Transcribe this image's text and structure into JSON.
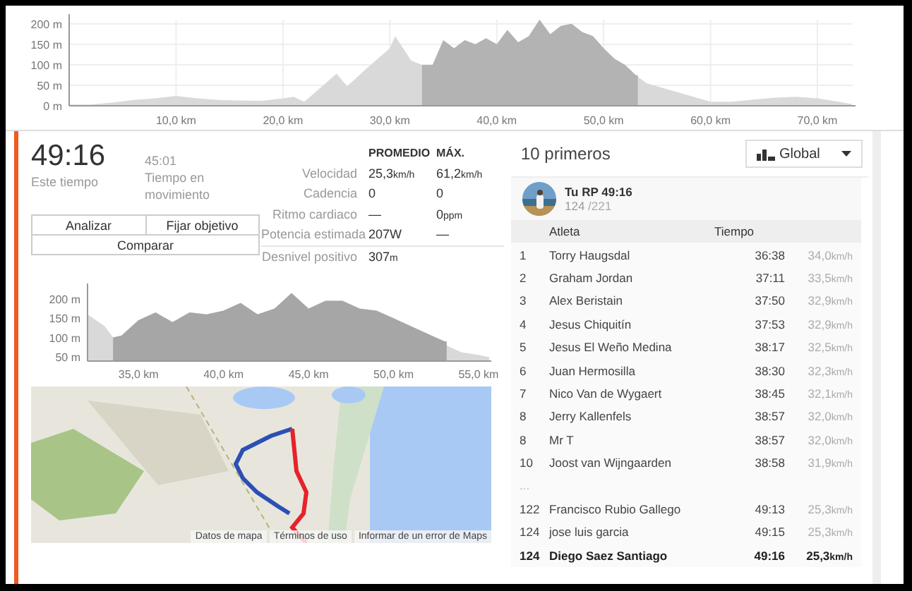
{
  "elevation_chart": {
    "chart_data": {
      "type": "area",
      "x": [
        0,
        2,
        4,
        6,
        8,
        10,
        12,
        14,
        16,
        18,
        20,
        21,
        22,
        24,
        25,
        26,
        28,
        30,
        30.5,
        32,
        33,
        34,
        35,
        36,
        37,
        38,
        39,
        40,
        41,
        42,
        43,
        44,
        45,
        46,
        47,
        48,
        49,
        50,
        51,
        52,
        53,
        54,
        56,
        58,
        60,
        62,
        64,
        66,
        68,
        70,
        72,
        73
      ],
      "series": [
        {
          "color": "#d9d9d9",
          "values": [
            3,
            3,
            8,
            14,
            18,
            24,
            18,
            14,
            13,
            12,
            18,
            22,
            10,
            55,
            78,
            48,
            95,
            140,
            170,
            110,
            100,
            100,
            160,
            140,
            160,
            150,
            165,
            150,
            185,
            155,
            170,
            210,
            175,
            195,
            200,
            180,
            170,
            140,
            115,
            100,
            75,
            55,
            40,
            25,
            10,
            10,
            15,
            20,
            22,
            18,
            10,
            5
          ]
        },
        {
          "color": "#b3b3b3",
          "values": [
            null,
            null,
            null,
            null,
            null,
            null,
            null,
            null,
            null,
            null,
            null,
            null,
            null,
            null,
            null,
            null,
            null,
            null,
            null,
            null,
            100,
            100,
            160,
            140,
            160,
            150,
            165,
            150,
            185,
            155,
            170,
            210,
            175,
            195,
            200,
            180,
            170,
            140,
            115,
            100,
            75,
            null,
            null,
            null,
            null,
            null,
            null,
            null,
            null,
            null,
            null,
            null
          ]
        }
      ],
      "xlim": [
        0,
        73.3
      ],
      "ylim": [
        0,
        210
      ],
      "grid": true,
      "xticks": [
        {
          "value": 10,
          "label": "10,0 km"
        },
        {
          "value": 20,
          "label": "20,0 km"
        },
        {
          "value": 30,
          "label": "30,0 km"
        },
        {
          "value": 40,
          "label": "40,0 km"
        },
        {
          "value": 50,
          "label": "50,0 km"
        },
        {
          "value": 60,
          "label": "60,0 km"
        },
        {
          "value": 70,
          "label": "70,0 km"
        }
      ],
      "yticks": [
        {
          "value": 0,
          "label": "0 m"
        },
        {
          "value": 50,
          "label": "50 m"
        },
        {
          "value": 100,
          "label": "100 m"
        },
        {
          "value": 150,
          "label": "150 m"
        },
        {
          "value": 200,
          "label": "200 m"
        }
      ]
    }
  },
  "summary": {
    "elapsed": {
      "value": "49:16",
      "label": "Este tiempo"
    },
    "moving": {
      "value": "45:01",
      "label": "Tiempo en movimiento"
    }
  },
  "actions": [
    "Analizar",
    "Fijar objetivo",
    "Comparar"
  ],
  "stats": {
    "columns": [
      "PROMEDIO",
      "MÁX."
    ],
    "rows": [
      {
        "label": "Velocidad",
        "avg": "25,3",
        "avg_unit": "km/h",
        "max": "61,2",
        "max_unit": "km/h"
      },
      {
        "label": "Cadencia",
        "avg": "0",
        "max": "0"
      },
      {
        "label": "Ritmo cardiaco",
        "avg": "—",
        "max": "0",
        "max_unit": "ppm"
      },
      {
        "label": "Potencia estimada",
        "avg": "207W",
        "max": "—"
      },
      {
        "label": "Desnivel positivo",
        "avg": "307",
        "avg_unit": "m"
      }
    ]
  },
  "segment_chart": {
    "chart_data": {
      "type": "area",
      "x": [
        32,
        33,
        33.5,
        34,
        35,
        36,
        37,
        38,
        39,
        40,
        41,
        42,
        43,
        44,
        45,
        46,
        47,
        48,
        49,
        50,
        51,
        52,
        53,
        53.5,
        54,
        55,
        55.5
      ],
      "series": [
        {
          "color": "#d9d9d9",
          "values": [
            160,
            130,
            100,
            105,
            145,
            165,
            140,
            165,
            160,
            170,
            190,
            160,
            175,
            215,
            175,
            195,
            195,
            175,
            170,
            150,
            130,
            110,
            82,
            72,
            62,
            55,
            50
          ]
        },
        {
          "color": "#a6a6a6",
          "values": [
            null,
            null,
            100,
            105,
            145,
            165,
            140,
            165,
            160,
            170,
            190,
            160,
            175,
            215,
            175,
            195,
            195,
            175,
            170,
            150,
            130,
            110,
            90,
            null,
            null,
            null,
            null
          ]
        }
      ],
      "xlim": [
        32,
        55.5
      ],
      "ylim": [
        39,
        240
      ],
      "xticks": [
        {
          "value": 35,
          "label": "35,0 km"
        },
        {
          "value": 40,
          "label": "40,0 km"
        },
        {
          "value": 45,
          "label": "45,0 km"
        },
        {
          "value": 50,
          "label": "50,0 km"
        },
        {
          "value": 55,
          "label": "55,0 km"
        }
      ],
      "yticks": [
        {
          "value": 50,
          "label": "50 m"
        },
        {
          "value": 100,
          "label": "100 m"
        },
        {
          "value": 150,
          "label": "150 m"
        },
        {
          "value": 200,
          "label": "200 m"
        }
      ]
    }
  },
  "map": {
    "links": [
      "Datos de mapa",
      "Términos de uso",
      "Informar de un error de Maps"
    ]
  },
  "leaderboard": {
    "title": "10 primeros",
    "filter": "Global",
    "personal": {
      "label": "Tu RP 49:16",
      "rank": "124",
      "total": "/221"
    },
    "columns": [
      "Atleta",
      "Tiempo"
    ],
    "rows": [
      {
        "kind": "athlete",
        "rank": "1",
        "name": "Torry Haugsdal",
        "time": "36:38",
        "speed": "34,0",
        "unit": "km/h",
        "current": false
      },
      {
        "kind": "athlete",
        "rank": "2",
        "name": "Graham Jordan",
        "time": "37:11",
        "speed": "33,5",
        "unit": "km/h",
        "current": false
      },
      {
        "kind": "athlete",
        "rank": "3",
        "name": "Alex Beristain",
        "time": "37:50",
        "speed": "32,9",
        "unit": "km/h",
        "current": false
      },
      {
        "kind": "athlete",
        "rank": "4",
        "name": "Jesus Chiquitín",
        "time": "37:53",
        "speed": "32,9",
        "unit": "km/h",
        "current": false
      },
      {
        "kind": "athlete",
        "rank": "5",
        "name": "Jesus El Weño Medina",
        "time": "38:17",
        "speed": "32,5",
        "unit": "km/h",
        "current": false
      },
      {
        "kind": "athlete",
        "rank": "6",
        "name": "Juan Hermosilla",
        "time": "38:30",
        "speed": "32,3",
        "unit": "km/h",
        "current": false
      },
      {
        "kind": "athlete",
        "rank": "7",
        "name": "Nico Van de Wygaert",
        "time": "38:45",
        "speed": "32,1",
        "unit": "km/h",
        "current": false
      },
      {
        "kind": "athlete",
        "rank": "8",
        "name": "Jerry Kallenfels",
        "time": "38:57",
        "speed": "32,0",
        "unit": "km/h",
        "current": false
      },
      {
        "kind": "athlete",
        "rank": "8",
        "name": "Mr T",
        "time": "38:57",
        "speed": "32,0",
        "unit": "km/h",
        "current": false
      },
      {
        "kind": "athlete",
        "rank": "10",
        "name": "Joost van Wijngaarden",
        "time": "38:58",
        "speed": "31,9",
        "unit": "km/h",
        "current": false
      },
      {
        "kind": "gap",
        "text": "..."
      },
      {
        "kind": "athlete",
        "rank": "122",
        "name": "Francisco Rubio Gallego",
        "time": "49:13",
        "speed": "25,3",
        "unit": "km/h",
        "current": false
      },
      {
        "kind": "athlete",
        "rank": "124",
        "name": "jose luis garcia",
        "time": "49:15",
        "speed": "25,3",
        "unit": "km/h",
        "current": false
      },
      {
        "kind": "athlete",
        "rank": "124",
        "name": "Diego Saez Santiago",
        "time": "49:16",
        "speed": "25,3",
        "unit": "km/h",
        "current": true
      }
    ]
  }
}
